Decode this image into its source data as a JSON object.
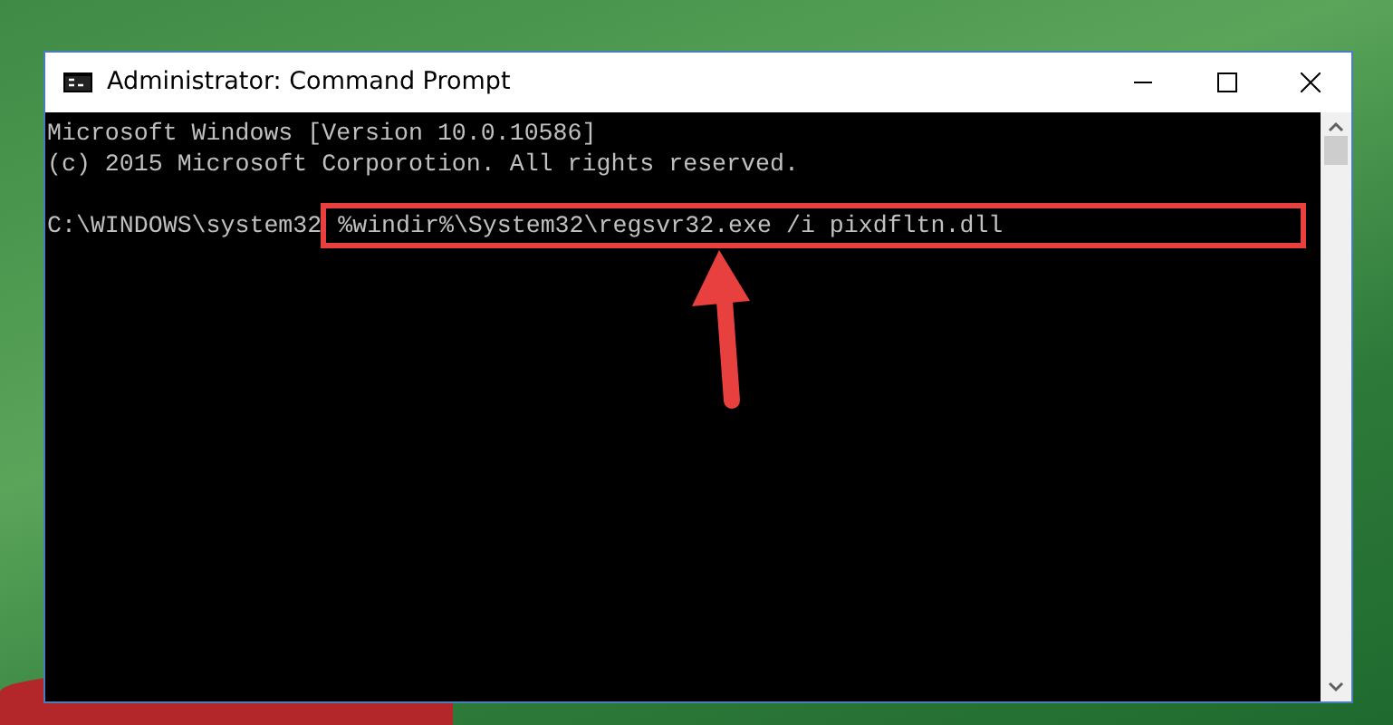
{
  "window": {
    "title": "Administrator: Command Prompt"
  },
  "console": {
    "lines": [
      {
        "kind": "text",
        "text": "Microsoft Windows [Version 10.0.10586]"
      },
      {
        "kind": "text",
        "text": "(c) 2015 Microsoft Corporotion. All rights reserved."
      },
      {
        "kind": "blank"
      },
      {
        "kind": "command",
        "prompt": "C:\\WINDOWS\\system32",
        "command": "%windir%\\System32\\regsvr32.exe /i pixdfltn.dll",
        "highlighted": true
      }
    ]
  }
}
